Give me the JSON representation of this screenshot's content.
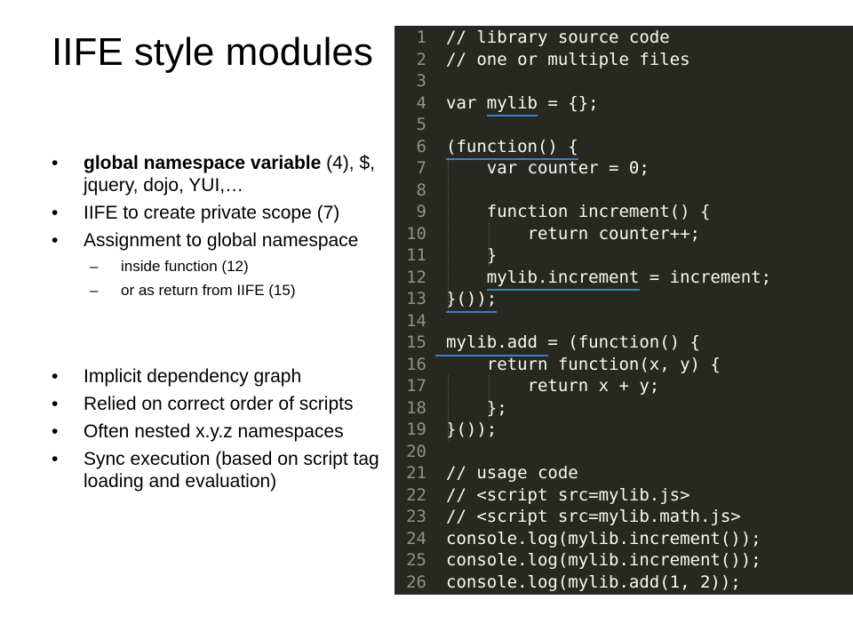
{
  "slide": {
    "title": "IIFE style modules",
    "bullets_top": [
      {
        "bold": "global namespace variable",
        "text": " (4), $, jquery, dojo, YUI,…"
      },
      {
        "text": "IIFE to create private scope (7)"
      },
      {
        "text": "Assignment to global namespace"
      }
    ],
    "sub_bullets": [
      "inside function (12)",
      "or as return from IIFE (15)"
    ],
    "bullets_bottom": [
      "Implicit dependency graph",
      "Relied on correct order of scripts",
      "Often nested x.y.z namespaces",
      "Sync execution (based on script tag loading and evaluation)"
    ]
  },
  "code": {
    "colors": {
      "background": "#272822",
      "text": "#f8f8f2",
      "line_number": "#8f908a",
      "underline": "#3f7fc4"
    },
    "lines": [
      {
        "n": "1",
        "text": "// library source code"
      },
      {
        "n": "2",
        "text": "// one or multiple files"
      },
      {
        "n": "3",
        "text": ""
      },
      {
        "n": "4",
        "text": "var mylib = {};"
      },
      {
        "n": "5",
        "text": ""
      },
      {
        "n": "6",
        "text": "(function() {"
      },
      {
        "n": "7",
        "text": "    var counter = 0;"
      },
      {
        "n": "8",
        "text": ""
      },
      {
        "n": "9",
        "text": "    function increment() {"
      },
      {
        "n": "10",
        "text": "        return counter++;"
      },
      {
        "n": "11",
        "text": "    }"
      },
      {
        "n": "12",
        "text": "    mylib.increment = increment;"
      },
      {
        "n": "13",
        "text": "}());"
      },
      {
        "n": "14",
        "text": ""
      },
      {
        "n": "15",
        "text": "mylib.add = (function() {"
      },
      {
        "n": "16",
        "text": "    return function(x, y) {"
      },
      {
        "n": "17",
        "text": "        return x + y;"
      },
      {
        "n": "18",
        "text": "    };"
      },
      {
        "n": "19",
        "text": "}());"
      },
      {
        "n": "20",
        "text": ""
      },
      {
        "n": "21",
        "text": "// usage code"
      },
      {
        "n": "22",
        "text": "// <script src=mylib.js>"
      },
      {
        "n": "23",
        "text": "// <script src=mylib.math.js>"
      },
      {
        "n": "24",
        "text": "console.log(mylib.increment());"
      },
      {
        "n": "25",
        "text": "console.log(mylib.increment());"
      },
      {
        "n": "26",
        "text": "console.log(mylib.add(1, 2));"
      }
    ]
  }
}
